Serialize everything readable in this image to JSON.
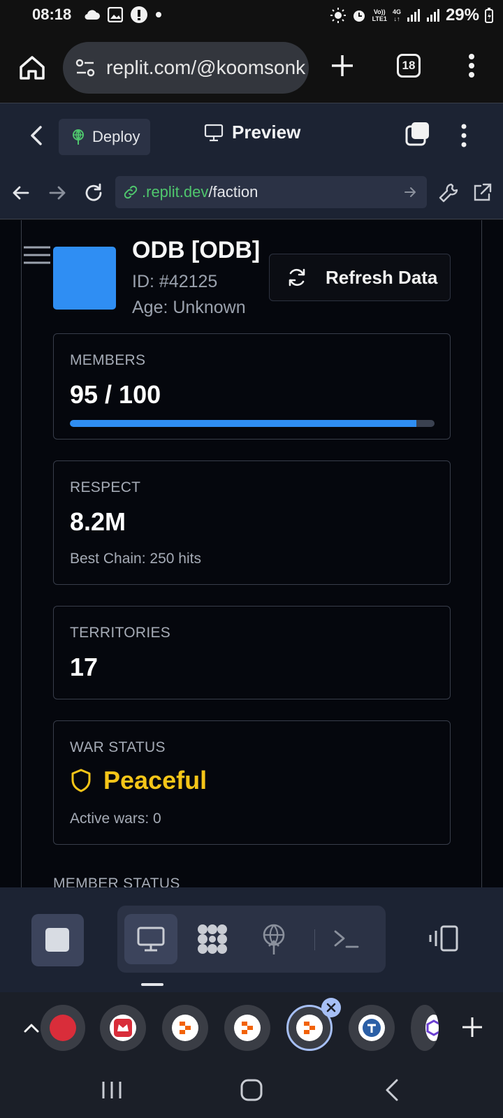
{
  "status_bar": {
    "time": "08:18",
    "battery": "29%",
    "network_top": "Vo))",
    "network_bottom": "LTE1",
    "network_gen": "4G"
  },
  "browser": {
    "url": "replit.com/@koomsonk",
    "tab_count": "18"
  },
  "replit_header": {
    "deploy_label": "Deploy",
    "preview_label": "Preview"
  },
  "webview": {
    "address_domain": ".replit.dev",
    "address_path": "/faction"
  },
  "faction": {
    "name": "ODB [ODB]",
    "id": "ID: #42125",
    "age": "Age: Unknown",
    "logo_color": "#2f8ef3",
    "refresh_label": "Refresh Data"
  },
  "cards": {
    "members": {
      "label": "MEMBERS",
      "value": "95 / 100",
      "fill_fraction": 0.95
    },
    "respect": {
      "label": "RESPECT",
      "value": "8.2M",
      "sub": "Best Chain: 250 hits"
    },
    "territories": {
      "label": "TERRITORIES",
      "value": "17"
    },
    "war": {
      "label": "WAR STATUS",
      "value": "Peaceful",
      "sub": "Active wars: 0",
      "status_color": "#f5c518"
    }
  },
  "next_section": "MEMBER STATUS",
  "toolbar": {
    "tools": [
      "preview-icon",
      "workspace-icon",
      "deploy-icon",
      "shell-icon"
    ]
  },
  "colors": {
    "accent_blue": "#2f8ef3",
    "war_yellow": "#f5c518",
    "panel": "#1c2333"
  }
}
